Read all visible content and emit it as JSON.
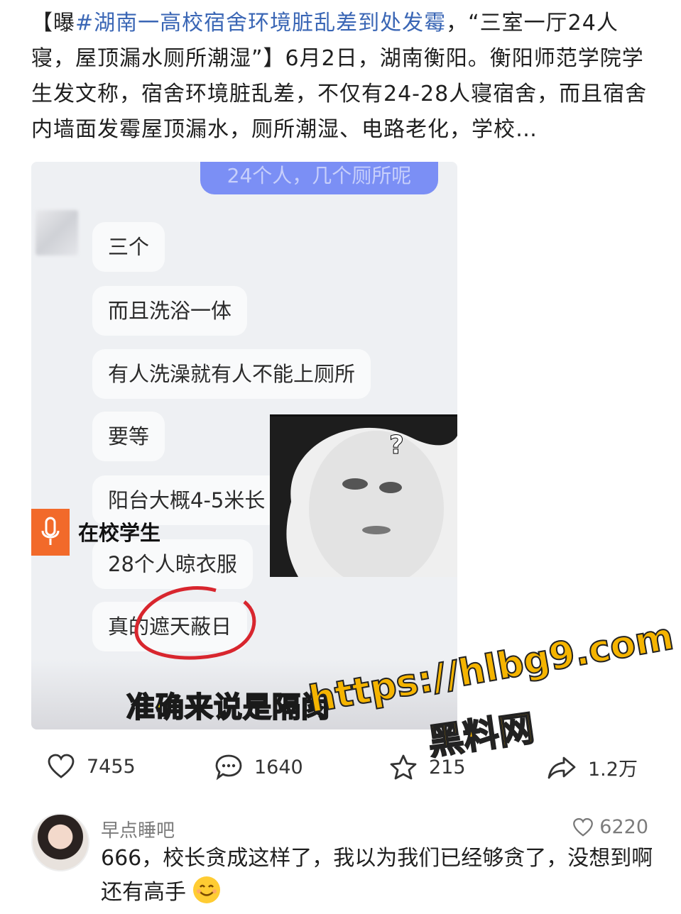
{
  "post": {
    "prefix": "【曝",
    "topic": "#湖南一高校宿舍环境脏乱差到处发霉",
    "body": "，“三室一厅24人寝，屋顶漏水厕所潮湿”】6月2日，湖南衡阳。衡阳师范学院学生发文称，宿舍环境脏乱差，不仅有24-28人寝宿舍，而且宿舍内墙面发霉屋顶漏水，厕所潮湿、电路老化，学校…"
  },
  "media": {
    "top_bubble": "24个人，几个厕所呢",
    "messages": [
      "三个",
      "而且洗浴一体",
      "有人洗澡就有人不能上厕所",
      "要等",
      "阳台大概4-5米长",
      "28个人晾衣服",
      "真的遮天蔽日"
    ],
    "speaker_label": "在校学生",
    "face_question": "?",
    "caption": "准确来说是隔阂"
  },
  "watermark": {
    "url": "https://hlbg9.com",
    "site": "黑料网"
  },
  "actions": {
    "likes": "7455",
    "comments": "1640",
    "favorites": "215",
    "shares": "1.2万"
  },
  "comment": {
    "username": "早点睡吧",
    "likes": "6220",
    "text": "666，校长贪成这样了，我以为我们已经够贪了，没想到啊还有高手"
  },
  "icons": {
    "like": "heart-icon",
    "comment": "comment-bubble-icon",
    "favorite": "star-icon",
    "share": "share-arrow-icon",
    "mic": "microphone-icon",
    "emoji": "smile-emoji-icon"
  },
  "colors": {
    "topic_link": "#3a66b5",
    "bubble_user": "#7b8ff5",
    "mic_orange": "#f26a2a",
    "caption_yellow": "#ffe000",
    "circle_red": "#d8262e"
  }
}
